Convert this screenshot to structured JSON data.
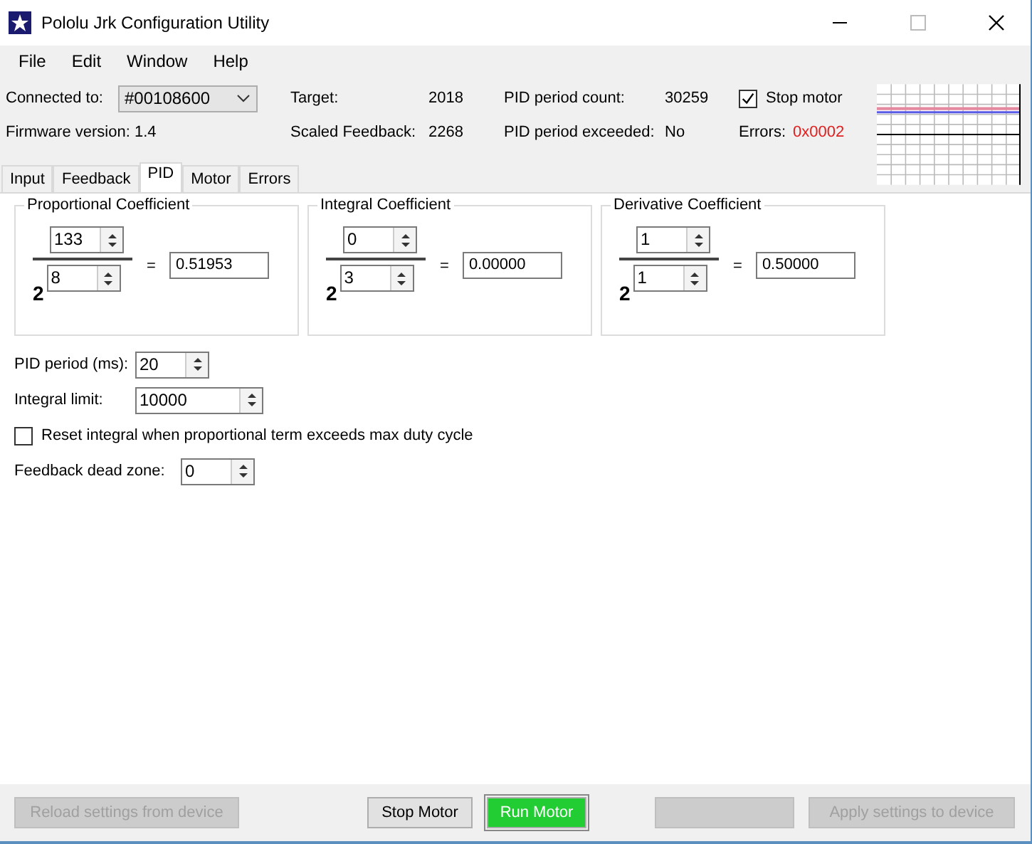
{
  "window": {
    "title": "Pololu Jrk Configuration Utility"
  },
  "menu": [
    "File",
    "Edit",
    "Window",
    "Help"
  ],
  "status": {
    "connected_label": "Connected to:",
    "device": "#00108600",
    "firmware": "Firmware version: 1.4",
    "fields": [
      {
        "label": "Target:",
        "value": "2018"
      },
      {
        "label": "Scaled Feedback:",
        "value": "2268"
      },
      {
        "label": "PID period count:",
        "value": "30259"
      },
      {
        "label": "PID period exceeded:",
        "value": "No"
      }
    ],
    "stop_motor": {
      "label": "Stop motor",
      "checked": true
    },
    "errors": {
      "label": "Errors:",
      "value": "0x0002"
    }
  },
  "tabs": [
    {
      "label": "Input",
      "selected": false
    },
    {
      "label": "Feedback",
      "selected": false
    },
    {
      "label": "PID",
      "selected": true
    },
    {
      "label": "Motor",
      "selected": false
    },
    {
      "label": "Errors",
      "selected": false
    }
  ],
  "coefficients": [
    {
      "title": "Proportional Coefficient",
      "numerator": "133",
      "base": "2",
      "exponent": "8",
      "equals": "=",
      "result": "0.51953"
    },
    {
      "title": "Integral Coefficient",
      "numerator": "0",
      "base": "2",
      "exponent": "3",
      "equals": "=",
      "result": "0.00000"
    },
    {
      "title": "Derivative Coefficient",
      "numerator": "1",
      "base": "2",
      "exponent": "1",
      "equals": "=",
      "result": "0.50000"
    }
  ],
  "settings": [
    {
      "kind": "spin",
      "label": "PID period (ms):",
      "value": "20",
      "wide": false
    },
    {
      "kind": "spin",
      "label": "Integral limit:",
      "value": "10000",
      "wide": true
    },
    {
      "kind": "check",
      "label": "Reset integral when proportional term exceeds max duty cycle",
      "checked": false
    },
    {
      "kind": "spin",
      "label": "Feedback dead zone:",
      "value": "0",
      "wide": false
    }
  ],
  "buttons": [
    {
      "label": "Reload settings from device",
      "disabled": true,
      "highlighted": false
    },
    {
      "label": "Stop Motor",
      "disabled": false,
      "highlighted": false
    },
    {
      "label": "Run Motor",
      "disabled": false,
      "highlighted": true
    },
    {
      "disabled": true,
      "highlighted": false
    },
    {
      "label": "Apply settings to device",
      "disabled": true,
      "highlighted": false
    }
  ]
}
